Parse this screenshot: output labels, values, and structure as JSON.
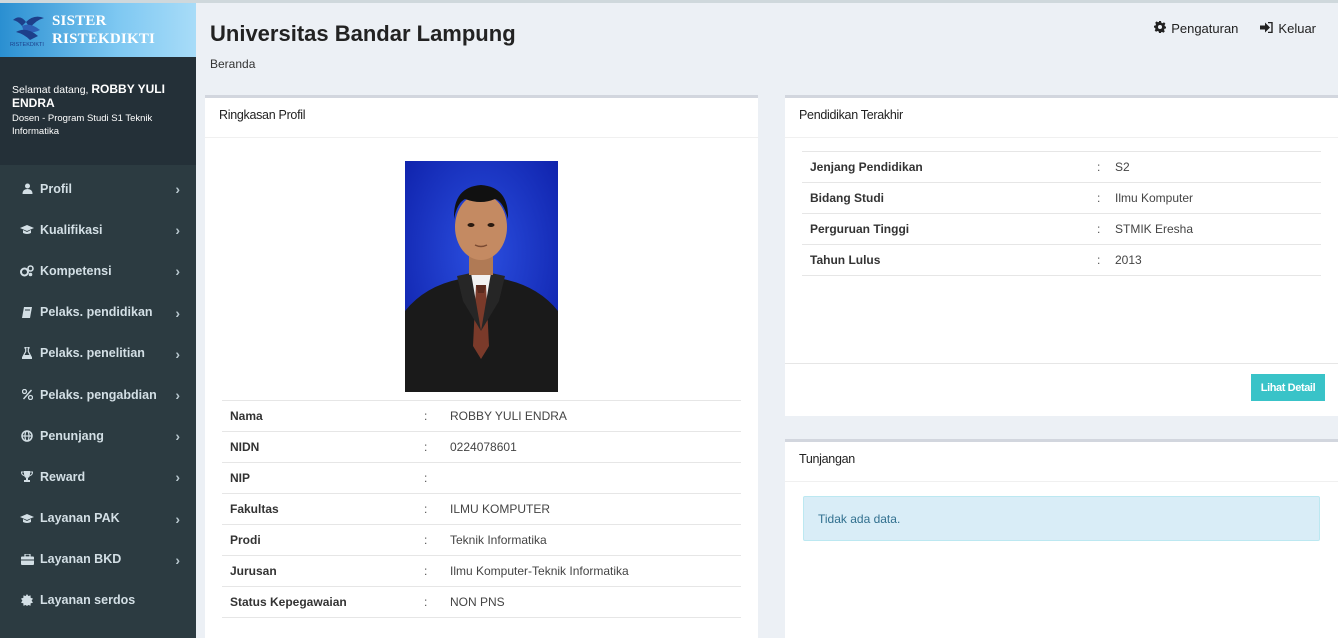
{
  "app": {
    "logo_line1": "SISTER",
    "logo_line2": "RISTEKDIKTI",
    "logo_small": "RISTEKDIKTI",
    "brand_color": "#2a8fd1"
  },
  "user": {
    "greeting": "Selamat datang,",
    "name": "ROBBY YULI ENDRA",
    "role": "Dosen - Program Studi S1 Teknik Informatika"
  },
  "sidebar": {
    "items": [
      {
        "label": "Profil",
        "icon": "user-icon"
      },
      {
        "label": "Kualifikasi",
        "icon": "graduation-cap-icon"
      },
      {
        "label": "Kompetensi",
        "icon": "cogs-icon"
      },
      {
        "label": "Pelaks. pendidikan",
        "icon": "book-icon"
      },
      {
        "label": "Pelaks. penelitian",
        "icon": "flask-icon"
      },
      {
        "label": "Pelaks. pengabdian",
        "icon": "percent-icon"
      },
      {
        "label": "Penunjang",
        "icon": "globe-icon"
      },
      {
        "label": "Reward",
        "icon": "trophy-icon"
      },
      {
        "label": "Layanan PAK",
        "icon": "graduation-cap-icon"
      },
      {
        "label": "Layanan BKD",
        "icon": "briefcase-icon"
      },
      {
        "label": "Layanan serdos",
        "icon": "certificate-icon"
      }
    ]
  },
  "header": {
    "title": "Universitas Bandar Lampung",
    "breadcrumb": "Beranda",
    "settings_label": "Pengaturan",
    "logout_label": "Keluar"
  },
  "profile": {
    "box_title": "Ringkasan Profil",
    "rows": [
      {
        "key": "Nama",
        "sep": ":",
        "value": "ROBBY YULI ENDRA"
      },
      {
        "key": "NIDN",
        "sep": ":",
        "value": "0224078601"
      },
      {
        "key": "NIP",
        "sep": ":",
        "value": ""
      },
      {
        "key": "Fakultas",
        "sep": ":",
        "value": "ILMU KOMPUTER"
      },
      {
        "key": "Prodi",
        "sep": ":",
        "value": "Teknik Informatika"
      },
      {
        "key": "Jurusan",
        "sep": ":",
        "value": "Ilmu Komputer-Teknik Informatika"
      },
      {
        "key": "Status Kepegawaian",
        "sep": ":",
        "value": "NON PNS"
      }
    ]
  },
  "education": {
    "box_title": "Pendidikan Terakhir",
    "rows": [
      {
        "key": "Jenjang Pendidikan",
        "sep": ":",
        "value": "S2"
      },
      {
        "key": "Bidang Studi",
        "sep": ":",
        "value": "Ilmu Komputer"
      },
      {
        "key": "Perguruan Tinggi",
        "sep": ":",
        "value": "STMIK Eresha"
      },
      {
        "key": "Tahun Lulus",
        "sep": ":",
        "value": "2013"
      }
    ],
    "detail_button": "Lihat Detail"
  },
  "allowance": {
    "box_title": "Tunjangan",
    "empty_text": "Tidak ada data."
  }
}
